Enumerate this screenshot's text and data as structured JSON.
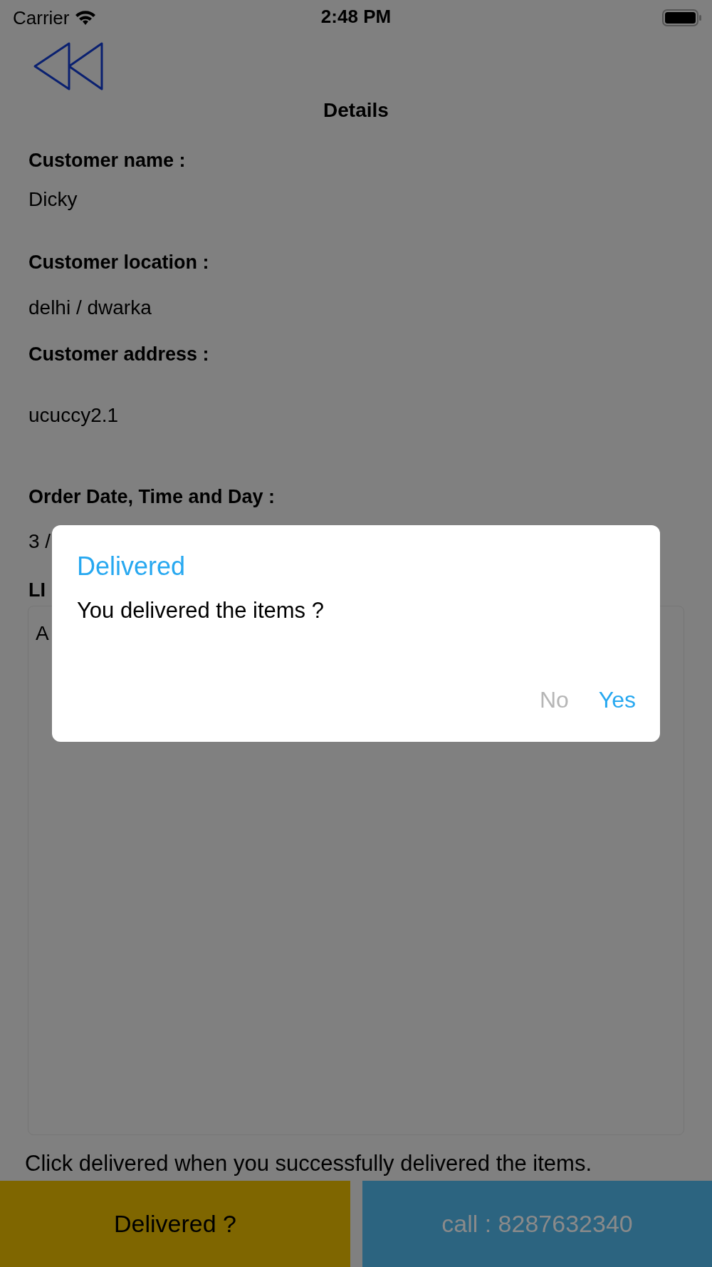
{
  "status_bar": {
    "carrier": "Carrier",
    "time": "2:48 PM"
  },
  "header": {
    "title": "Details"
  },
  "fields": [
    {
      "label": "Customer name :",
      "value": "Dicky"
    },
    {
      "label": "Customer location :",
      "value": "delhi / dwarka"
    },
    {
      "label": "Customer address :",
      "value": "ucuccy2.1"
    },
    {
      "label": "Order Date, Time and Day :",
      "value": "3 /"
    }
  ],
  "list": {
    "label": "LI",
    "text": "A"
  },
  "note": "Click delivered when you successfully delivered the items.",
  "actions": [
    {
      "label": "Delivered ?",
      "kind": "deliver"
    },
    {
      "label": "call : 8287632340",
      "kind": "call"
    }
  ],
  "dialog": {
    "title": "Delivered",
    "message": "You delivered the items ?",
    "buttons": [
      {
        "label": "No",
        "kind": "cancel"
      },
      {
        "label": "Yes",
        "kind": "confirm"
      }
    ]
  }
}
